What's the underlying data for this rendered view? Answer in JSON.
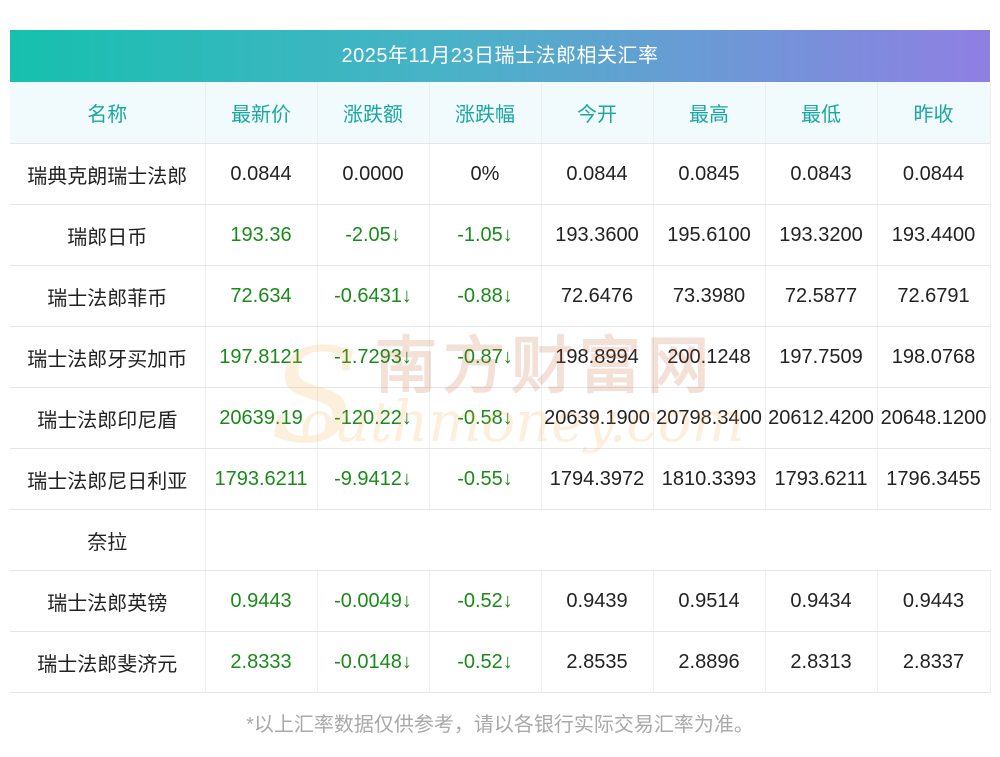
{
  "title": "2025年11月23日瑞士法郎相关汇率",
  "headers": [
    "名称",
    "最新价",
    "涨跌额",
    "涨跌幅",
    "今开",
    "最高",
    "最低",
    "昨收"
  ],
  "rows": [
    {
      "name": "瑞典克朗瑞士法郎",
      "latest": "0.0844",
      "change": "0.0000",
      "pct": "0%",
      "open": "0.0844",
      "high": "0.0845",
      "low": "0.0843",
      "prev": "0.0844"
    },
    {
      "name": "瑞郎日币",
      "latest": "193.36",
      "change": "-2.05↓",
      "pct": "-1.05↓",
      "open": "193.3600",
      "high": "195.6100",
      "low": "193.3200",
      "prev": "193.4400"
    },
    {
      "name": "瑞士法郎菲币",
      "latest": "72.634",
      "change": "-0.6431↓",
      "pct": "-0.88↓",
      "open": "72.6476",
      "high": "73.3980",
      "low": "72.5877",
      "prev": "72.6791"
    },
    {
      "name": "瑞士法郎牙买加币",
      "latest": "197.8121",
      "change": "-1.7293↓",
      "pct": "-0.87↓",
      "open": "198.8994",
      "high": "200.1248",
      "low": "197.7509",
      "prev": "198.0768"
    },
    {
      "name": "瑞士法郎印尼盾",
      "latest": "20639.19",
      "change": "-120.22↓",
      "pct": "-0.58↓",
      "open": "20639.1900",
      "high": "20798.3400",
      "low": "20612.4200",
      "prev": "20648.1200"
    },
    {
      "name": "瑞士法郎尼日利亚",
      "latest": "1793.6211",
      "change": "-9.9412↓",
      "pct": "-0.55↓",
      "open": "1794.3972",
      "high": "1810.3393",
      "low": "1793.6211",
      "prev": "1796.3455"
    },
    {
      "name": "奈拉"
    },
    {
      "name": "瑞士法郎英镑",
      "latest": "0.9443",
      "change": "-0.0049↓",
      "pct": "-0.52↓",
      "open": "0.9439",
      "high": "0.9514",
      "low": "0.9434",
      "prev": "0.9443"
    },
    {
      "name": "瑞士法郎斐济元",
      "latest": "2.8333",
      "change": "-0.0148↓",
      "pct": "-0.52↓",
      "open": "2.8535",
      "high": "2.8896",
      "low": "2.8313",
      "prev": "2.8337"
    }
  ],
  "watermark": {
    "cn": "南方财富网",
    "en": "outhmoney.com",
    "letter": "S"
  },
  "footnote": "*以上汇率数据仅供参考，请以各银行实际交易汇率为准。",
  "colors": {
    "header_text": "#1aa7a0",
    "change_down": "#1a8a1a",
    "gradient_start": "#16c0ae",
    "gradient_end": "#8f7fe3"
  }
}
